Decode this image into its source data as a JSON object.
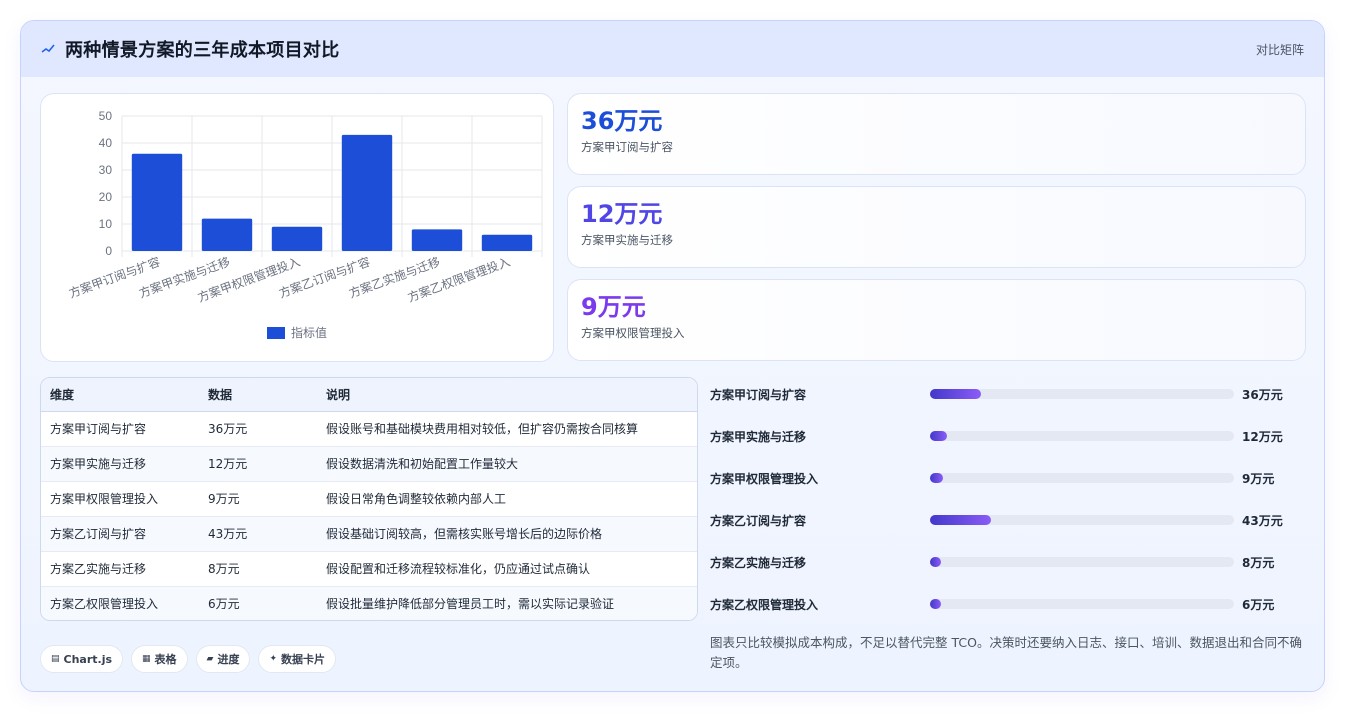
{
  "header": {
    "title": "两种情景方案的三年成本项目对比",
    "tag": "对比矩阵",
    "icon": "sparkline-icon"
  },
  "chart_data": {
    "type": "bar",
    "categories": [
      "方案甲订阅与扩容",
      "方案甲实施与迁移",
      "方案甲权限管理投入",
      "方案乙订阅与扩容",
      "方案乙实施与迁移",
      "方案乙权限管理投入"
    ],
    "series": [
      {
        "name": "指标值",
        "values": [
          36,
          12,
          9,
          43,
          8,
          6
        ],
        "color": "#1d4ed8"
      }
    ],
    "ylim": [
      0,
      50
    ],
    "yticks": [
      "0",
      "10",
      "20",
      "30",
      "40",
      "50"
    ],
    "legend": "bottom",
    "grid": true
  },
  "stats": [
    {
      "value": "36万元",
      "label": "方案甲订阅与扩容",
      "color": "#1d4ed8"
    },
    {
      "value": "12万元",
      "label": "方案甲实施与迁移",
      "color": "#4f46e5"
    },
    {
      "value": "9万元",
      "label": "方案甲权限管理投入",
      "color": "#7c3aed"
    }
  ],
  "table": {
    "headers": [
      "维度",
      "数据",
      "说明"
    ],
    "rows": [
      [
        "方案甲订阅与扩容",
        "36万元",
        "假设账号和基础模块费用相对较低，但扩容仍需按合同核算"
      ],
      [
        "方案甲实施与迁移",
        "12万元",
        "假设数据清洗和初始配置工作量较大"
      ],
      [
        "方案甲权限管理投入",
        "9万元",
        "假设日常角色调整较依赖内部人工"
      ],
      [
        "方案乙订阅与扩容",
        "43万元",
        "假设基础订阅较高，但需核实账号增长后的边际价格"
      ],
      [
        "方案乙实施与迁移",
        "8万元",
        "假设配置和迁移流程较标准化，仍应通过试点确认"
      ],
      [
        "方案乙权限管理投入",
        "6万元",
        "假设批量维护降低部分管理员工时，需以实际记录验证"
      ]
    ]
  },
  "progress": [
    {
      "label": "方案甲订阅与扩容",
      "value": "36万元",
      "ratio": 0.167
    },
    {
      "label": "方案甲实施与迁移",
      "value": "12万元",
      "ratio": 0.056
    },
    {
      "label": "方案甲权限管理投入",
      "value": "9万元",
      "ratio": 0.042
    },
    {
      "label": "方案乙订阅与扩容",
      "value": "43万元",
      "ratio": 0.2
    },
    {
      "label": "方案乙实施与迁移",
      "value": "8万元",
      "ratio": 0.037
    },
    {
      "label": "方案乙权限管理投入",
      "value": "6万元",
      "ratio": 0.028
    }
  ],
  "note": "图表只比较模拟成本构成，不足以替代完整 TCO。决策时还要纳入日志、接口、培训、数据退出和合同不确定项。",
  "chips": [
    {
      "glyph": "▤",
      "label": "Chart.js",
      "icon": "chart-icon"
    },
    {
      "glyph": "▦",
      "label": "表格",
      "icon": "table-icon"
    },
    {
      "glyph": "▰",
      "label": "进度",
      "icon": "progress-icon"
    },
    {
      "glyph": "✦",
      "label": "数据卡片",
      "icon": "card-icon"
    }
  ]
}
